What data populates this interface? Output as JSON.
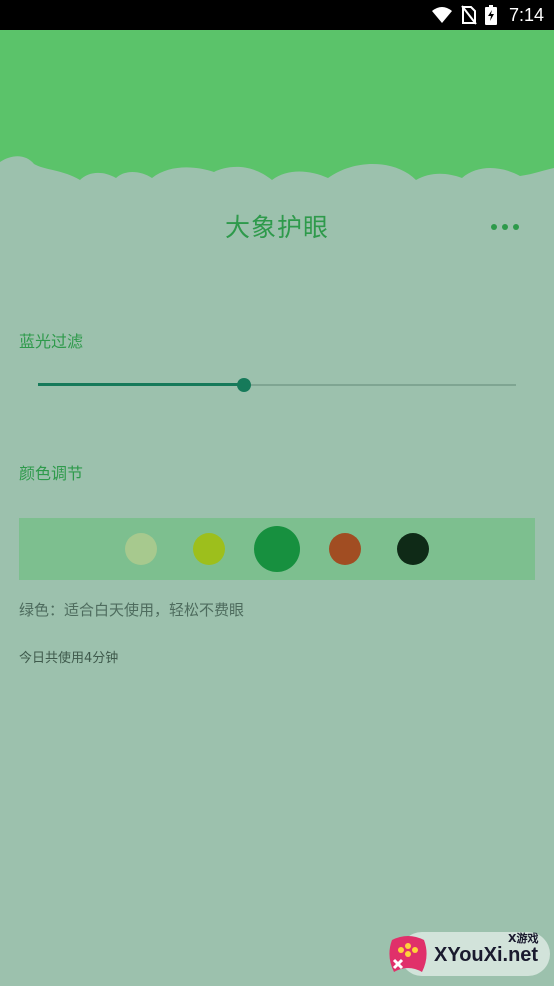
{
  "status_bar": {
    "time": "7:14",
    "icons": [
      "wifi-icon",
      "no-sim-icon",
      "battery-charging-icon"
    ]
  },
  "app": {
    "title": "大象护眼",
    "more_icon": "more-dots-icon"
  },
  "blue_light": {
    "label": "蓝光过滤",
    "level_fraction": 0.43
  },
  "color_adjust": {
    "label": "颜色调节",
    "swatches": [
      {
        "color": "#a7c98e",
        "selected": false
      },
      {
        "color": "#9dbf1c",
        "selected": false
      },
      {
        "color": "#17903f",
        "selected": true
      },
      {
        "color": "#a14d22",
        "selected": false
      },
      {
        "color": "#0f2a17",
        "selected": false
      }
    ],
    "description": "绿色：适合白天使用，轻松不费眼"
  },
  "usage": {
    "text": "今日共使用4分钟"
  },
  "watermark": {
    "main": "XYouXi.net",
    "sub": "X游戏"
  },
  "colors": {
    "header_green": "#5bc36a",
    "background": "#9cc1ad",
    "accent_green": "#2e9a4b",
    "slider_teal": "#167a5a"
  }
}
